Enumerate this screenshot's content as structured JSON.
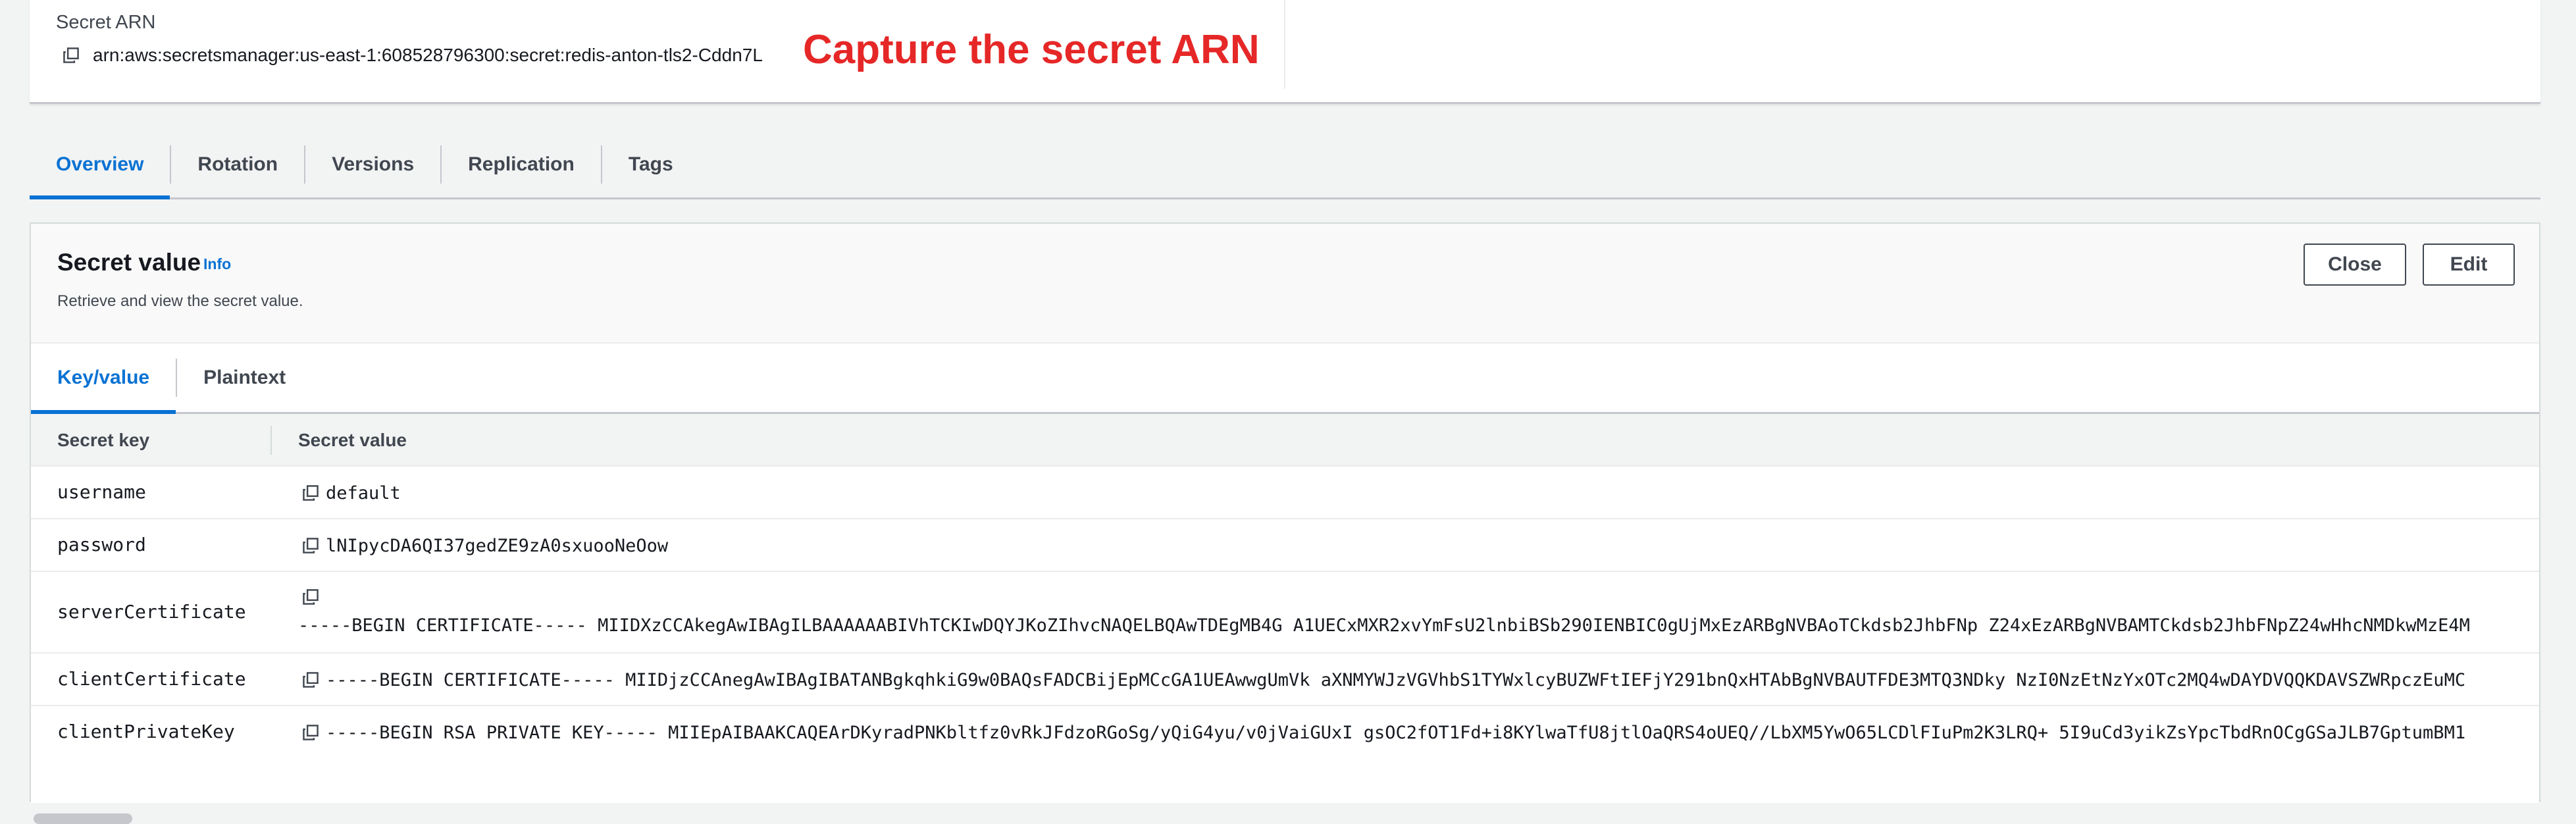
{
  "arn_panel": {
    "label": "Secret ARN",
    "value": "arn:aws:secretsmanager:us-east-1:608528796300:secret:redis-anton-tls2-Cddn7L"
  },
  "annotation": "Capture the secret ARN",
  "main_tabs": [
    {
      "label": "Overview",
      "active": true
    },
    {
      "label": "Rotation",
      "active": false
    },
    {
      "label": "Versions",
      "active": false
    },
    {
      "label": "Replication",
      "active": false
    },
    {
      "label": "Tags",
      "active": false
    }
  ],
  "secret_value": {
    "title": "Secret value",
    "info": "Info",
    "description": "Retrieve and view the secret value.",
    "close_label": "Close",
    "edit_label": "Edit",
    "sub_tabs": [
      {
        "label": "Key/value",
        "active": true
      },
      {
        "label": "Plaintext",
        "active": false
      }
    ]
  },
  "table": {
    "headers": [
      "Secret key",
      "Secret value"
    ],
    "rows": [
      {
        "key": "username",
        "value": "default"
      },
      {
        "key": "password",
        "value": "lNIpycDA6QI37gedZE9zA0sxuooNeOow"
      },
      {
        "key": "serverCertificate",
        "value": "-----BEGIN CERTIFICATE----- MIIDXzCCAkegAwIBAgILBAAAAAABIVhTCKIwDQYJKoZIhvcNAQELBQAwTDEgMB4G A1UECxMXR2xvYmFsU2lnbiBSb290IENBIC0gUjMxEzARBgNVBAoTCkdsb2JhbFNp Z24xEzARBgNVBAMTCkdsb2JhbFNpZ24wHhcNMDkwMzE4M"
      },
      {
        "key": "clientCertificate",
        "value": "-----BEGIN CERTIFICATE----- MIIDjzCCAnegAwIBAgIBATANBgkqhkiG9w0BAQsFADCBijEpMCcGA1UEAwwgUmVk aXNMYWJzVGVhbS1TYWxlcyBUZWFtIEFjY291bnQxHTAbBgNVBAUTFDE3MTQ3NDky NzI0NzEtNzYxOTc2MQ4wDAYDVQQKDAVSZWRpczEuMC"
      },
      {
        "key": "clientPrivateKey",
        "value": "-----BEGIN RSA PRIVATE KEY----- MIIEpAIBAAKCAQEArDKyradPNKbltfz0vRkJFdzoRGoSg/yQiG4yu/v0jVaiGUxI gsOC2fOT1Fd+i8KYlwaTfU8jtlOaQRS4oUEQ//LbXM5YwO65LCDlFIuPm2K3LRQ+ 5I9uCd3yikZsYpcTbdRnOCgGSaJLB7GptumBM1"
      }
    ]
  },
  "colors": {
    "accent": "#0972d3",
    "annotation": "#e62727",
    "border": "#c6c6cd"
  },
  "icons": {
    "copy": "copy-icon"
  }
}
